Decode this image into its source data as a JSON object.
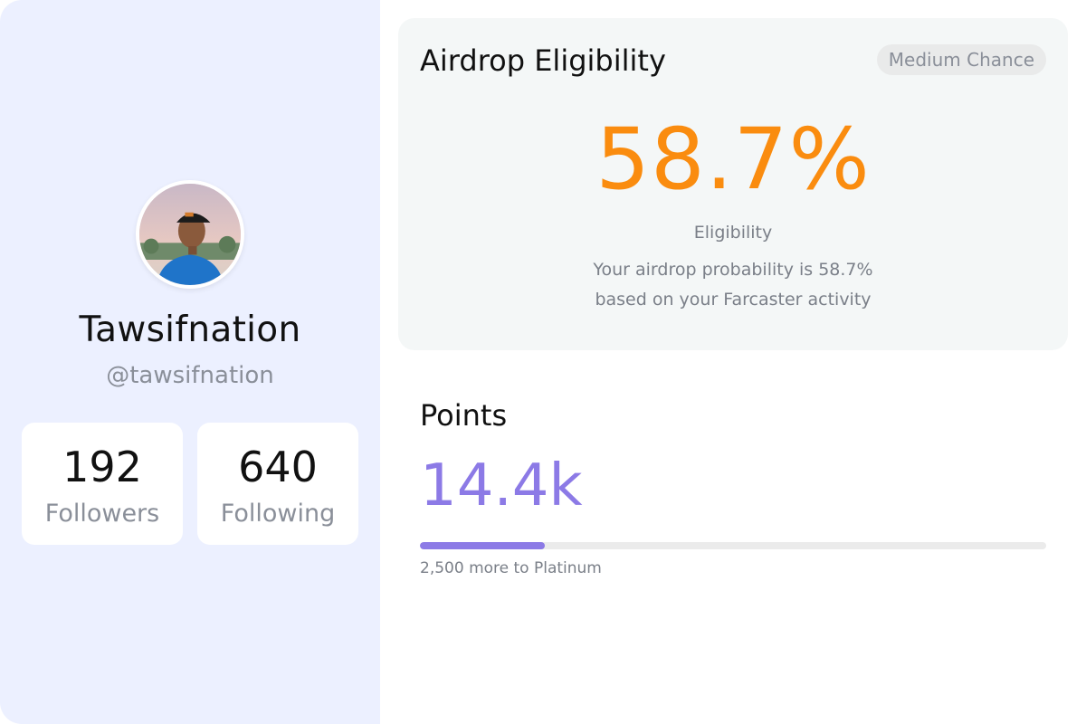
{
  "profile": {
    "display_name": "Tawsifnation",
    "handle": "@tawsifnation",
    "avatar_alt": "Profile photo",
    "stats": {
      "followers_value": "192",
      "followers_label": "Followers",
      "following_value": "640",
      "following_label": "Following"
    }
  },
  "eligibility": {
    "title": "Airdrop Eligibility",
    "badge": "Medium Chance",
    "percent": "58.7%",
    "label": "Eligibility",
    "description_line1": "Your airdrop probability is 58.7%",
    "description_line2": "based on your Farcaster activity",
    "accent_color": "#fa8c0f"
  },
  "points": {
    "title": "Points",
    "value": "14.4k",
    "progress_fraction": 0.2,
    "caption": "2,500 more to Platinum",
    "accent_color": "#8c7ae6"
  }
}
